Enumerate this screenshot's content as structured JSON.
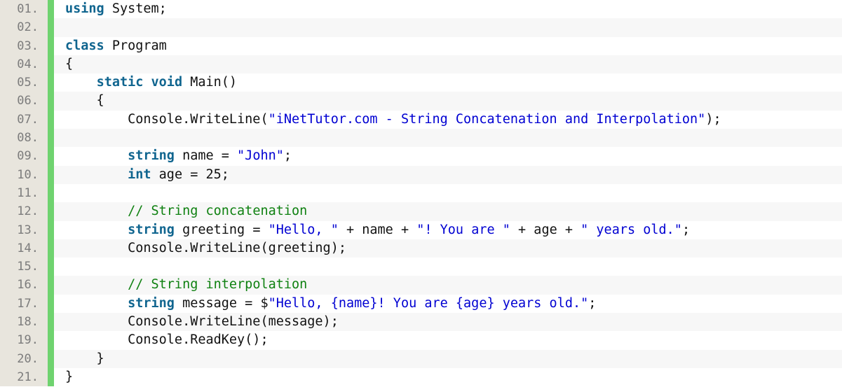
{
  "editor": {
    "language": "csharp",
    "line_number_suffix": ".",
    "gutter_color": "#e8e5dd",
    "marker_color": "#6fd36f",
    "stripe_color": "#f7f7f7",
    "background_color": "#ffffff",
    "colors": {
      "keyword": "#10658f",
      "string": "#0000d2",
      "comment": "#0f8111",
      "plain": "#111111",
      "line_number": "#7c7c7c"
    },
    "lines": [
      {
        "number": "01.",
        "text": "using System;",
        "tokens": [
          {
            "t": "using",
            "c": "kw"
          },
          {
            "t": " System;",
            "c": "plain"
          }
        ]
      },
      {
        "number": "02.",
        "text": "",
        "tokens": []
      },
      {
        "number": "03.",
        "text": "class Program",
        "tokens": [
          {
            "t": "class",
            "c": "kw"
          },
          {
            "t": " Program",
            "c": "plain"
          }
        ]
      },
      {
        "number": "04.",
        "text": "{",
        "tokens": [
          {
            "t": "{",
            "c": "plain"
          }
        ]
      },
      {
        "number": "05.",
        "text": "    static void Main()",
        "tokens": [
          {
            "t": "    ",
            "c": "plain"
          },
          {
            "t": "static",
            "c": "kw"
          },
          {
            "t": " ",
            "c": "plain"
          },
          {
            "t": "void",
            "c": "kw"
          },
          {
            "t": " Main()",
            "c": "plain"
          }
        ]
      },
      {
        "number": "06.",
        "text": "    {",
        "tokens": [
          {
            "t": "    {",
            "c": "plain"
          }
        ]
      },
      {
        "number": "07.",
        "text": "        Console.WriteLine(\"iNetTutor.com - String Concatenation and Interpolation\");",
        "tokens": [
          {
            "t": "        Console.WriteLine(",
            "c": "plain"
          },
          {
            "t": "\"iNetTutor.com - String Concatenation and Interpolation\"",
            "c": "str"
          },
          {
            "t": ");",
            "c": "plain"
          }
        ]
      },
      {
        "number": "08.",
        "text": "",
        "tokens": []
      },
      {
        "number": "09.",
        "text": "        string name = \"John\";",
        "tokens": [
          {
            "t": "        ",
            "c": "plain"
          },
          {
            "t": "string",
            "c": "kw"
          },
          {
            "t": " name = ",
            "c": "plain"
          },
          {
            "t": "\"John\"",
            "c": "str"
          },
          {
            "t": ";",
            "c": "plain"
          }
        ]
      },
      {
        "number": "10.",
        "text": "        int age = 25;",
        "tokens": [
          {
            "t": "        ",
            "c": "plain"
          },
          {
            "t": "int",
            "c": "kw"
          },
          {
            "t": " age = 25;",
            "c": "plain"
          }
        ]
      },
      {
        "number": "11.",
        "text": "",
        "tokens": []
      },
      {
        "number": "12.",
        "text": "        // String concatenation",
        "tokens": [
          {
            "t": "        ",
            "c": "plain"
          },
          {
            "t": "// String concatenation",
            "c": "com"
          }
        ]
      },
      {
        "number": "13.",
        "text": "        string greeting = \"Hello, \" + name + \"! You are \" + age + \" years old.\";",
        "tokens": [
          {
            "t": "        ",
            "c": "plain"
          },
          {
            "t": "string",
            "c": "kw"
          },
          {
            "t": " greeting = ",
            "c": "plain"
          },
          {
            "t": "\"Hello, \"",
            "c": "str"
          },
          {
            "t": " + name + ",
            "c": "plain"
          },
          {
            "t": "\"! You are \"",
            "c": "str"
          },
          {
            "t": " + age + ",
            "c": "plain"
          },
          {
            "t": "\" years old.\"",
            "c": "str"
          },
          {
            "t": ";",
            "c": "plain"
          }
        ]
      },
      {
        "number": "14.",
        "text": "        Console.WriteLine(greeting);",
        "tokens": [
          {
            "t": "        Console.WriteLine(greeting);",
            "c": "plain"
          }
        ]
      },
      {
        "number": "15.",
        "text": "",
        "tokens": []
      },
      {
        "number": "16.",
        "text": "        // String interpolation",
        "tokens": [
          {
            "t": "        ",
            "c": "plain"
          },
          {
            "t": "// String interpolation",
            "c": "com"
          }
        ]
      },
      {
        "number": "17.",
        "text": "        string message = $\"Hello, {name}! You are {age} years old.\";",
        "tokens": [
          {
            "t": "        ",
            "c": "plain"
          },
          {
            "t": "string",
            "c": "kw"
          },
          {
            "t": " message = $",
            "c": "plain"
          },
          {
            "t": "\"Hello, {name}! You are {age} years old.\"",
            "c": "str"
          },
          {
            "t": ";",
            "c": "plain"
          }
        ]
      },
      {
        "number": "18.",
        "text": "        Console.WriteLine(message);",
        "tokens": [
          {
            "t": "        Console.WriteLine(message);",
            "c": "plain"
          }
        ]
      },
      {
        "number": "19.",
        "text": "        Console.ReadKey();",
        "tokens": [
          {
            "t": "        Console.ReadKey();",
            "c": "plain"
          }
        ]
      },
      {
        "number": "20.",
        "text": "    }",
        "tokens": [
          {
            "t": "    }",
            "c": "plain"
          }
        ]
      },
      {
        "number": "21.",
        "text": "}",
        "tokens": [
          {
            "t": "}",
            "c": "plain"
          }
        ]
      }
    ]
  }
}
